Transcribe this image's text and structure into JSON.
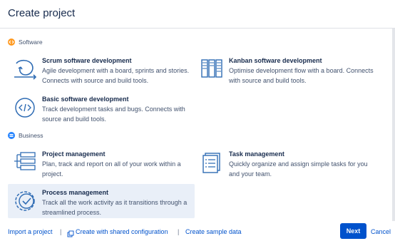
{
  "dialog": {
    "title": "Create project"
  },
  "sections": {
    "software": {
      "label": "Software"
    },
    "business": {
      "label": "Business"
    }
  },
  "templates": [
    {
      "name": "Scrum software development",
      "desc": "Agile development with a board, sprints and stories. Connects with source and build tools.",
      "icon": "scrum-cycle-icon"
    },
    {
      "name": "Kanban software development",
      "desc": "Optimise development flow with a board. Connects with source and build tools.",
      "icon": "kanban-board-icon"
    },
    {
      "name": "Basic software development",
      "desc": "Track development tasks and bugs. Connects with source and build tools.",
      "icon": "code-brackets-icon"
    },
    {
      "name": "Project management",
      "desc": "Plan, track and report on all of your work within a project.",
      "icon": "project-list-icon"
    },
    {
      "name": "Task management",
      "desc": "Quickly organize and assign simple tasks for you and your team.",
      "icon": "task-checklist-icon"
    },
    {
      "name": "Process management",
      "desc": "Track all the work activity as it transitions through a streamlined process.",
      "icon": "process-check-icon",
      "selected": true
    }
  ],
  "footer": {
    "import_label": "Import a project",
    "shared_config_label": "Create with shared configuration",
    "sample_label": "Create sample data",
    "separator": "|",
    "next_label": "Next",
    "cancel_label": "Cancel"
  },
  "colors": {
    "accent": "#0052cc",
    "software_badge": "#ff991f",
    "business_badge": "#2684ff",
    "selected_bg": "#e9eff8"
  }
}
